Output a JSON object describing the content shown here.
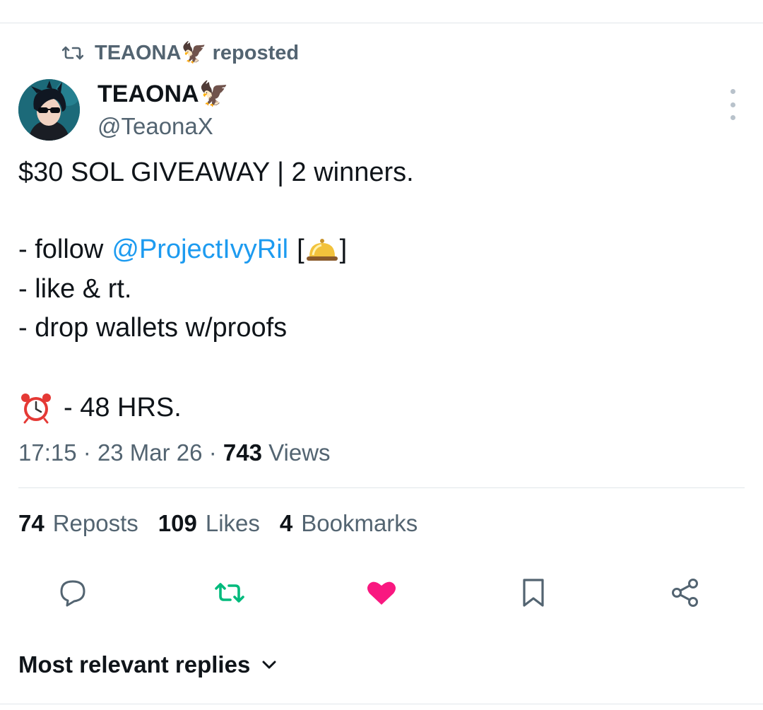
{
  "repost": {
    "label": "TEAONA🦅 reposted"
  },
  "author": {
    "name": "TEAONA🦅",
    "handle": "@TeaonaX"
  },
  "tweet": {
    "line1": "$30 SOL GIVEAWAY | 2 winners.",
    "line2_prefix": "- follow",
    "mention": "@ProjectIvyRil",
    "line2_suffix_open": "[",
    "line2_suffix_close": "]",
    "line3": "- like & rt.",
    "line4": "- drop wallets w/proofs",
    "line5": "- 48 HRS."
  },
  "meta": {
    "time": "17:15",
    "date": "23 Mar 26",
    "views_count": "743",
    "views_label": "Views",
    "sep": "·"
  },
  "stats": {
    "reposts_count": "74",
    "reposts_label": "Reposts",
    "likes_count": "109",
    "likes_label": "Likes",
    "bookmarks_count": "4",
    "bookmarks_label": "Bookmarks"
  },
  "actions": [
    "reply-icon",
    "repost-icon",
    "like-icon",
    "bookmark-icon",
    "share-icon"
  ],
  "colors": {
    "repost_active": "#00ba7c",
    "like_active": "#f91880",
    "mention": "#1d9bf0",
    "muted": "#536471"
  },
  "replies_sort": {
    "label": "Most relevant replies"
  }
}
